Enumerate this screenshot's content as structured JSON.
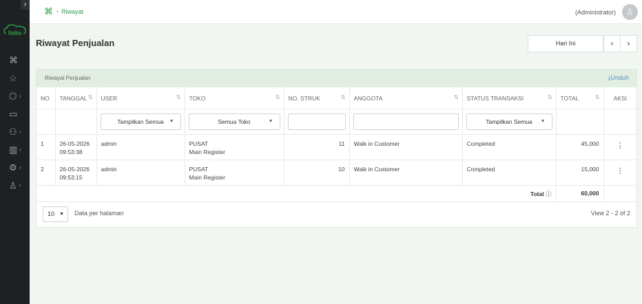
{
  "sidebar": {
    "expand_icon": "chevron-right-icon",
    "logo_text": "folio",
    "items": [
      {
        "icon": "⌘",
        "name": "command-icon",
        "caret": false
      },
      {
        "icon": "☆",
        "name": "star-icon",
        "caret": false
      },
      {
        "icon": "⬡",
        "name": "cube-icon",
        "caret": true
      },
      {
        "icon": "▭",
        "name": "book-icon",
        "caret": false
      },
      {
        "icon": "⚇",
        "name": "users-icon",
        "caret": true
      },
      {
        "icon": "▥",
        "name": "chart-icon",
        "caret": true
      },
      {
        "icon": "⚙",
        "name": "gear-icon",
        "caret": true
      },
      {
        "icon": "♙",
        "name": "user-icon",
        "caret": true
      }
    ]
  },
  "header": {
    "breadcrumb": "Riwayat",
    "user_role": "(Administrator)"
  },
  "page": {
    "title": "Riwayat Penjualan",
    "date_filter": "Hari Ini",
    "prev": "‹",
    "next": "›"
  },
  "card": {
    "title": "Riwayat Penjualan",
    "download": "Unduh"
  },
  "table": {
    "columns": [
      "NO",
      "TANGGAL",
      "USER",
      "TOKO",
      "NO. STRUK",
      "ANGGOTA",
      "STATUS TRANSAKSI",
      "TOTAL",
      "AKSI"
    ],
    "filters": {
      "user": "Tampilkan Semua",
      "toko": "Semua Toko",
      "status": "Tampilkan Semua"
    },
    "rows": [
      {
        "no": "1",
        "date": "26-05-2026",
        "time": "09:53:38",
        "user": "admin",
        "store": "PUSAT",
        "register": "Main Register",
        "receipt": "11",
        "member": "Walk in Customer",
        "status": "Completed",
        "total": "45,000"
      },
      {
        "no": "2",
        "date": "26-05-2026",
        "time": "09:53:15",
        "user": "admin",
        "store": "PUSAT",
        "register": "Main Register",
        "receipt": "10",
        "member": "Walk in Customer",
        "status": "Completed",
        "total": "15,000"
      }
    ],
    "total_label": "Total",
    "grand_total": "60,000"
  },
  "pagination": {
    "per_page": "10",
    "per_page_label": "Data per halaman",
    "view_info": "View 2 - 2 of 2"
  },
  "colors": {
    "accent": "#2e9e44",
    "sidebar": "#1d2124",
    "link": "#5a8cc2"
  }
}
